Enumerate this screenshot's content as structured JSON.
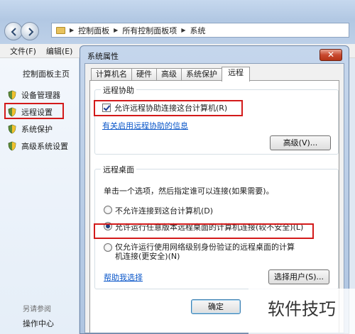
{
  "window": {
    "breadcrumb": [
      "控制面板",
      "所有控制面板项",
      "系统"
    ]
  },
  "menu": {
    "file": "文件(F)",
    "edit": "编辑(E)"
  },
  "sidebar": {
    "home": "控制面板主页",
    "items": [
      {
        "label": "设备管理器",
        "icon": "shield-icon"
      },
      {
        "label": "远程设置",
        "icon": "shield-icon",
        "highlighted": true
      },
      {
        "label": "系统保护",
        "icon": "shield-icon"
      },
      {
        "label": "高级系统设置",
        "icon": "shield-icon"
      }
    ],
    "see_also": "另请参阅",
    "action_center": "操作中心"
  },
  "dialog": {
    "title": "系统属性",
    "close_icon": "close-icon",
    "tabs": [
      "计算机名",
      "硬件",
      "高级",
      "系统保护",
      "远程"
    ],
    "active_tab": "远程",
    "assistance": {
      "legend": "远程协助",
      "checkbox_label": "允许远程协助连接这台计算机(R)",
      "checked": true,
      "link": "有关启用远程协助的信息",
      "advanced_button": "高级(V)..."
    },
    "desktop": {
      "legend": "远程桌面",
      "description": "单击一个选项，然后指定谁可以连接(如果需要)。",
      "options": [
        {
          "label": "不允许连接到这台计算机(D)",
          "selected": false
        },
        {
          "label": "允许运行任意版本远程桌面的计算机连接(较不安全)(L)",
          "selected": true
        },
        {
          "label": "仅允许运行使用网络级别身份验证的远程桌面的计算机连接(更安全)(N)",
          "selected": false
        }
      ],
      "help_link": "帮助我选择",
      "select_users_button": "选择用户(S)..."
    },
    "ok_button": "确定"
  },
  "watermark": "软件技巧",
  "colors": {
    "highlight": "#d31a1a",
    "link": "#0b57c9"
  }
}
